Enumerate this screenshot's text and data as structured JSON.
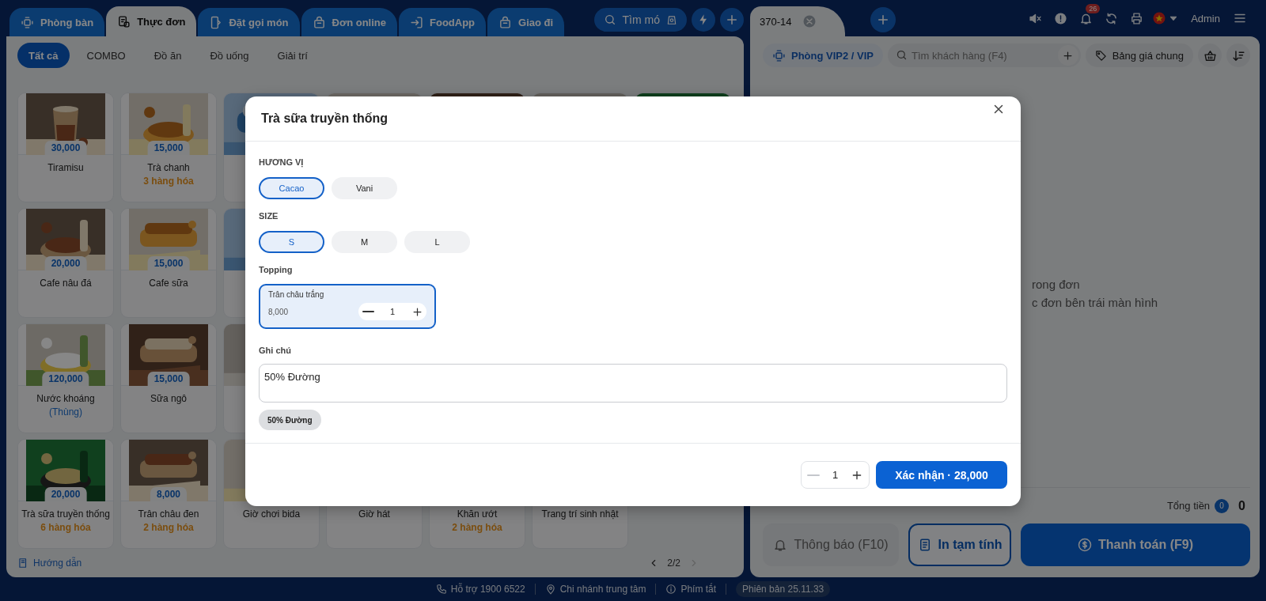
{
  "left_tabs": [
    {
      "label": "Phòng bàn",
      "selected": false
    },
    {
      "label": "Thực đơn",
      "selected": true
    },
    {
      "label": "Đặt gọi món",
      "selected": false
    },
    {
      "label": "Đơn online",
      "selected": false
    },
    {
      "label": "FoodApp",
      "selected": false
    },
    {
      "label": "Giao đi",
      "selected": false
    }
  ],
  "product_search": "Tìm mó",
  "order_tab": "370-14",
  "notification_count": "26",
  "user": "Admin",
  "categories": [
    {
      "label": "Tất cả",
      "selected": true
    },
    {
      "label": "COMBO",
      "selected": false
    },
    {
      "label": "Đồ ăn",
      "selected": false
    },
    {
      "label": "Đồ uống",
      "selected": false
    },
    {
      "label": "Giải trí",
      "selected": false
    }
  ],
  "product_rows": [
    [
      {
        "kind": "item",
        "price": "30,000",
        "name": "Tiramisu"
      },
      {
        "kind": "item",
        "price": "15,000",
        "name": "Trà chanh",
        "note": {
          "text": "3 hàng hóa",
          "kind": "variants"
        }
      },
      {
        "kind": "covered"
      },
      {
        "kind": "covered"
      },
      {
        "kind": "covered"
      },
      {
        "kind": "covered"
      },
      {
        "kind": "covered"
      }
    ],
    [
      {
        "kind": "item",
        "price": "20,000",
        "name": "Cafe nâu đá"
      },
      {
        "kind": "item",
        "price": "15,000",
        "name": "Cafe sữa"
      },
      {
        "kind": "covered"
      }
    ],
    [
      {
        "kind": "item",
        "price": "120,000",
        "name": "Nước khoáng",
        "note": {
          "text": "(Thùng)",
          "kind": "unit"
        }
      },
      {
        "kind": "item",
        "price": "15,000",
        "name": "Sữa ngô"
      },
      {
        "kind": "covered"
      }
    ],
    [
      {
        "kind": "item",
        "price": "20,000",
        "name": "Trà sữa truyền thống",
        "note": {
          "text": "6 hàng hóa",
          "kind": "variants"
        }
      },
      {
        "kind": "item",
        "price": "8,000",
        "name": "Trân châu đen",
        "note": {
          "text": "2 hàng hóa",
          "kind": "variants"
        }
      },
      {
        "kind": "picture_name",
        "name": "Giờ chơi bida"
      },
      {
        "kind": "name_only",
        "name": "Giờ hát"
      },
      {
        "kind": "name_only",
        "name": "Khăn ướt",
        "note": {
          "text": "2 hàng hóa",
          "kind": "variants"
        }
      },
      {
        "kind": "name_only",
        "name": "Trang trí sinh nhật"
      }
    ]
  ],
  "guide_link": "Hướng dẫn",
  "pager": {
    "page": "2/2",
    "next_disabled": true
  },
  "order": {
    "room": "Phòng VIP2 / VIP",
    "customer_search": {
      "placeholder": "Tìm khách hàng (F4)"
    },
    "price_list": "Bảng giá chung",
    "empty_lines": [
      "rong đơn",
      "c đơn bên trái màn hình"
    ],
    "total_label": "Tổng tiền",
    "item_count": "0",
    "total": "0"
  },
  "actions": [
    {
      "label": "Thông báo (F10)",
      "kind": "muted"
    },
    {
      "label": "In tạm tính",
      "kind": "outline"
    },
    {
      "label": "Thanh toán (F9)",
      "kind": "primary"
    }
  ],
  "status_bar": [
    {
      "text": "Hỗ trợ 1900 6522",
      "kind": "phone"
    },
    {
      "text": "Chi nhánh trung tâm",
      "kind": "branch"
    },
    {
      "text": "Phím tắt",
      "kind": "info"
    },
    {
      "text": "Phiên bản 25.11.33",
      "kind": "version"
    }
  ],
  "dialog": {
    "title": "Trà sữa truyền thống",
    "groups": [
      {
        "label": "HƯƠNG VỊ",
        "options": [
          {
            "label": "Cacao",
            "selected": true
          },
          {
            "label": "Vani",
            "selected": false
          }
        ]
      },
      {
        "label": "SIZE",
        "options": [
          {
            "label": "S",
            "selected": true
          },
          {
            "label": "M",
            "selected": false
          },
          {
            "label": "L",
            "selected": false
          }
        ]
      }
    ],
    "topping_label": "Topping",
    "toppings": [
      {
        "name": "Trân châu trắng",
        "price": "8,000",
        "quantity": "1",
        "selected": true
      }
    ],
    "note_label": "Ghi chú",
    "note": {
      "value": "50% Đường"
    },
    "quick_notes": [
      "50% Đường"
    ],
    "quantity": "1",
    "minus_disabled": true,
    "confirm": "Xác nhận · 28,000"
  }
}
